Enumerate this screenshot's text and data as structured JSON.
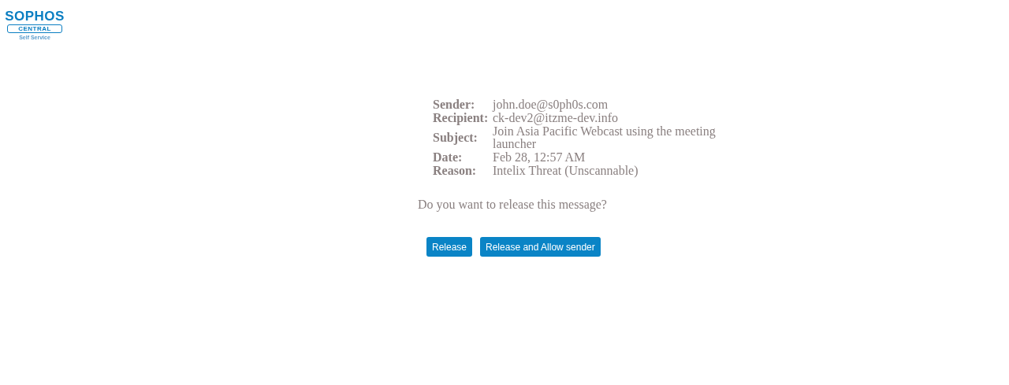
{
  "logo": {
    "brand": "SOPHOS",
    "product": "CENTRAL",
    "tagline": "Self Service"
  },
  "details": [
    {
      "label": "Sender:",
      "value": "john.doe@s0ph0s.com"
    },
    {
      "label": "Recipient:",
      "value": "ck-dev2@itzme-dev.info"
    },
    {
      "label": "Subject:",
      "value": "Join Asia Pacific Webcast using the meeting launcher"
    },
    {
      "label": "Date:",
      "value": "Feb 28, 12:57 AM"
    },
    {
      "label": "Reason:",
      "value": "Intelix Threat (Unscannable)"
    }
  ],
  "question": "Do you want to release this message?",
  "buttons": [
    "Release",
    "Release and Allow sender"
  ]
}
